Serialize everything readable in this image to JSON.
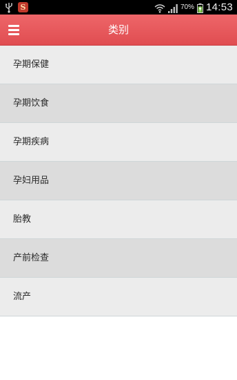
{
  "status_bar": {
    "battery_percent": "70%",
    "time": "14:53",
    "app_notification_glyph": "S",
    "icons": [
      "usb-icon",
      "app-notification-icon",
      "wifi-icon",
      "signal-icon",
      "battery-charging-icon"
    ]
  },
  "app_bar": {
    "title": "类别",
    "menu_icon": "hamburger-menu-icon",
    "background_color": "#e8595c"
  },
  "categories": [
    {
      "label": "孕期保健"
    },
    {
      "label": "孕期饮食"
    },
    {
      "label": "孕期疾病"
    },
    {
      "label": "孕妇用品"
    },
    {
      "label": "胎教"
    },
    {
      "label": "产前检查"
    },
    {
      "label": "流产"
    }
  ]
}
